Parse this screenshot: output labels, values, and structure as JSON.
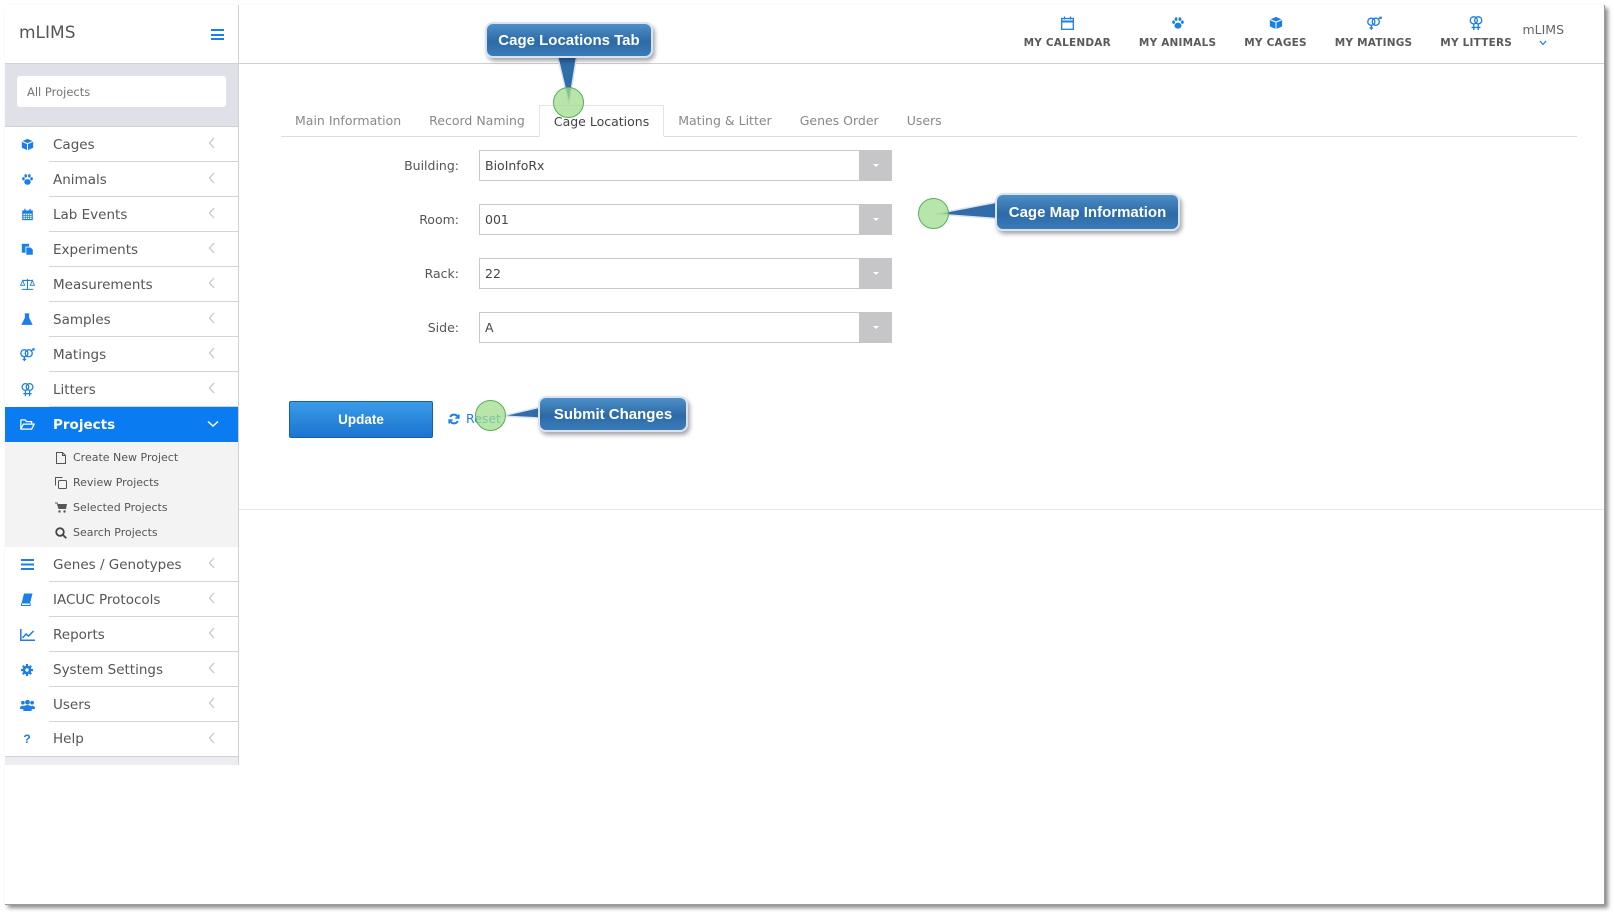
{
  "app": {
    "brand": "mLIMS",
    "project_selector": {
      "placeholder": "All Projects"
    }
  },
  "sidebar": {
    "items": [
      {
        "label": "Cages",
        "icon": "cube-icon"
      },
      {
        "label": "Animals",
        "icon": "paw-icon"
      },
      {
        "label": "Lab Events",
        "icon": "calendar-icon"
      },
      {
        "label": "Experiments",
        "icon": "files-icon"
      },
      {
        "label": "Measurements",
        "icon": "balance-scale-icon"
      },
      {
        "label": "Samples",
        "icon": "flask-icon"
      },
      {
        "label": "Matings",
        "icon": "mars-venus-icon"
      },
      {
        "label": "Litters",
        "icon": "venus-double-icon"
      },
      {
        "label": "Projects",
        "icon": "folder-open-icon",
        "active": true
      },
      {
        "label": "Genes / Genotypes",
        "icon": "bars-icon"
      },
      {
        "label": "IACUC Protocols",
        "icon": "book-icon"
      },
      {
        "label": "Reports",
        "icon": "line-chart-icon"
      },
      {
        "label": "System Settings",
        "icon": "gear-icon"
      },
      {
        "label": "Users",
        "icon": "users-icon"
      },
      {
        "label": "Help",
        "icon": "question-icon"
      }
    ],
    "projects_submenu": [
      {
        "label": "Create New Project",
        "icon": "file-icon"
      },
      {
        "label": "Review Projects",
        "icon": "copy-icon"
      },
      {
        "label": "Selected Projects",
        "icon": "cart-icon"
      },
      {
        "label": "Search Projects",
        "icon": "search-icon"
      }
    ]
  },
  "header": {
    "nav": [
      {
        "label": "MY CALENDAR",
        "icon": "calendar-icon"
      },
      {
        "label": "MY ANIMALS",
        "icon": "paw-icon"
      },
      {
        "label": "MY CAGES",
        "icon": "cube-icon"
      },
      {
        "label": "MY MATINGS",
        "icon": "mars-venus-icon"
      },
      {
        "label": "MY LITTERS",
        "icon": "venus-double-icon"
      }
    ],
    "user": "mLIMS"
  },
  "tabs": [
    {
      "label": "Main Information"
    },
    {
      "label": "Record Naming"
    },
    {
      "label": "Cage Locations",
      "active": true
    },
    {
      "label": "Mating & Litter"
    },
    {
      "label": "Genes Order"
    },
    {
      "label": "Users"
    }
  ],
  "form": {
    "building": {
      "label": "Building:",
      "value": "BioInfoRx"
    },
    "room": {
      "label": "Room:",
      "value": "001"
    },
    "rack": {
      "label": "Rack:",
      "value": "22"
    },
    "side": {
      "label": "Side:",
      "value": "A"
    },
    "update_label": "Update",
    "reset_label": "Reset"
  },
  "annotations": {
    "tab_callout": "Cage Locations Tab",
    "map_callout": "Cage Map Information",
    "submit_callout": "Submit Changes"
  },
  "colors": {
    "accent": "#0b7bf2",
    "icon": "#1a7fe6",
    "callout": "#2c6aa8",
    "marker": "#a0dc8c"
  }
}
